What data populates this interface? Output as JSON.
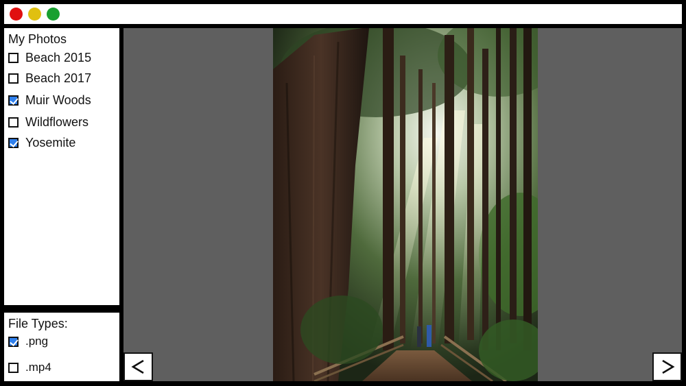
{
  "albums": {
    "title": "My Photos",
    "items": [
      {
        "label": "Beach 2015",
        "checked": false
      },
      {
        "label": "Beach 2017",
        "checked": false
      },
      {
        "label": "Muir Woods",
        "checked": true
      },
      {
        "label": "Wildflowers",
        "checked": false
      },
      {
        "label": "Yosemite",
        "checked": true
      }
    ]
  },
  "file_types": {
    "title": "File Types:",
    "items": [
      {
        "label": ".png",
        "checked": true
      },
      {
        "label": ".mp4",
        "checked": false
      }
    ]
  },
  "window_controls": {
    "close_color": "#e01010",
    "minimize_color": "#e0c010",
    "maximize_color": "#18a030"
  },
  "viewer": {
    "prev_icon": "chevron-left-icon",
    "next_icon": "chevron-right-icon",
    "accent_color": "#2f80ed"
  }
}
